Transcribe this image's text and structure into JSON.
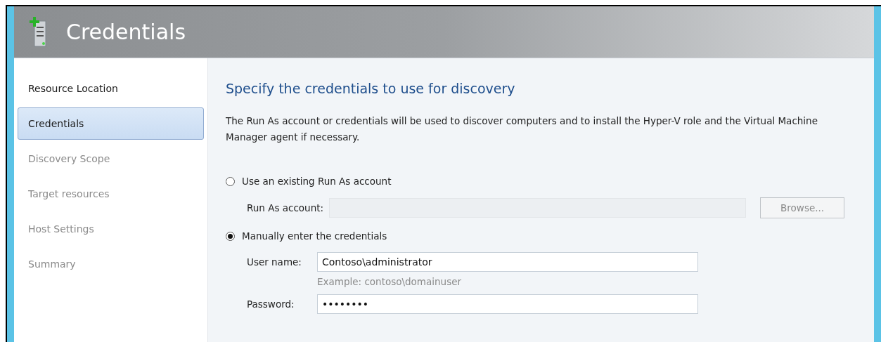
{
  "header": {
    "title": "Credentials"
  },
  "sidebar": {
    "items": [
      {
        "label": "Resource Location",
        "selected": false,
        "disabled": false
      },
      {
        "label": "Credentials",
        "selected": true,
        "disabled": false
      },
      {
        "label": "Discovery Scope",
        "selected": false,
        "disabled": true
      },
      {
        "label": "Target resources",
        "selected": false,
        "disabled": true
      },
      {
        "label": "Host Settings",
        "selected": false,
        "disabled": true
      },
      {
        "label": "Summary",
        "selected": false,
        "disabled": true
      }
    ]
  },
  "content": {
    "heading": "Specify the credentials to use for discovery",
    "description": "The Run As account or credentials will be used to discover computers and to install the Hyper-V role and the Virtual Machine Manager agent if necessary.",
    "options": [
      {
        "label": "Use an existing Run As account",
        "selected": false,
        "fields": [
          {
            "label": "Run As account:",
            "disabled": true,
            "button": {
              "label": "Browse...",
              "disabled": true
            }
          }
        ]
      },
      {
        "label": "Manually enter the credentials",
        "selected": true,
        "fields": [
          {
            "label": "User name:",
            "value": "Contoso\\administrator",
            "disabled": false,
            "hint": "Example: contoso\\domainuser"
          },
          {
            "label": "Password:",
            "value": "••••••••",
            "disabled": false
          }
        ]
      }
    ]
  }
}
